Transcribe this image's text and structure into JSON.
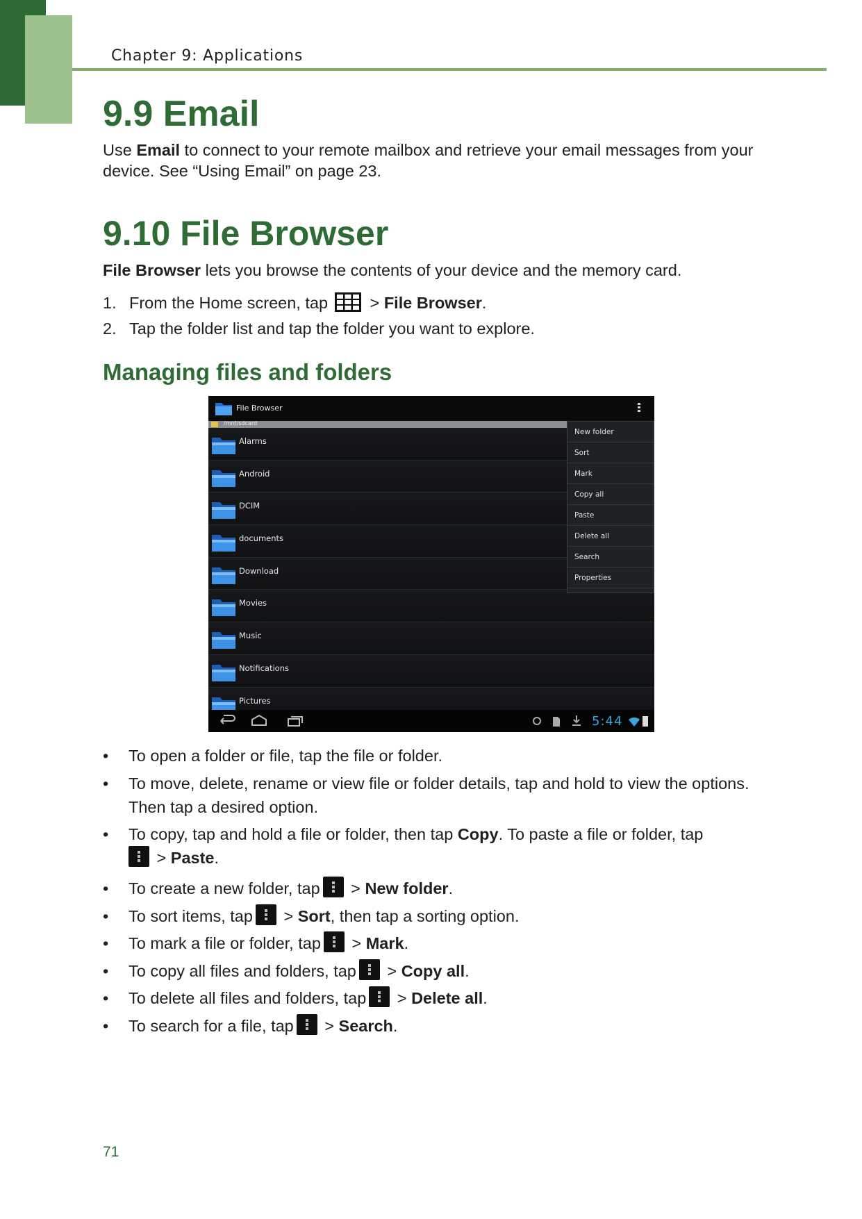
{
  "header": {
    "chapter": "Chapter 9: Applications"
  },
  "email_section": {
    "title": "9.9 Email",
    "text_pre": "Use ",
    "text_bold": "Email",
    "text_post": " to connect to your remote mailbox and retrieve your email messages from your device. See “Using Email” on page 23."
  },
  "fb_section": {
    "title": "9.10 File Browser",
    "intro_bold": "File Browser",
    "intro_rest": " lets you browse the contents of your device and the memory card.",
    "steps": [
      {
        "num": "1.",
        "pre": "From the Home screen, tap",
        "mid": " > ",
        "bold": "File Browser",
        "post": "."
      },
      {
        "num": "2.",
        "text": "Tap the folder list and tap the folder you want to explore."
      }
    ]
  },
  "managing": {
    "title": "Managing files and folders",
    "bullets": [
      {
        "pre": "To open a folder or file, tap the file or folder."
      },
      {
        "pre": "To move, delete, rename or view file or folder details, tap and hold to view the options. Then tap a desired option."
      },
      {
        "pre": "To copy, tap and hold a file or folder, then tap ",
        "bold": "Copy",
        "post": ". To paste a file or folder, tap",
        "bold2": "Paste",
        "post2": "."
      },
      {
        "pre": "To create a new folder, tap",
        "bold": "New folder",
        "post": "."
      },
      {
        "pre": "To sort items, tap",
        "bold": "Sort",
        "post": ", then tap a sorting option."
      },
      {
        "pre": "To mark a file or folder, tap",
        "bold": "Mark",
        "post": "."
      },
      {
        "pre": "To copy all files and folders, tap",
        "bold": "Copy all",
        "post": "."
      },
      {
        "pre": "To delete all files and folders, tap",
        "bold": "Delete all",
        "post": "."
      },
      {
        "pre": "To search for a file, tap",
        "bold": "Search",
        "post": "."
      }
    ]
  },
  "screenshot": {
    "app_title": "File Browser",
    "path": "/mnt/sdcard",
    "folders": [
      "Alarms",
      "Android",
      "DCIM",
      "documents",
      "Download",
      "Movies",
      "Music",
      "Notifications",
      "Pictures"
    ],
    "menu_items": [
      "New folder",
      "Sort",
      "Mark",
      "Copy all",
      "Paste",
      "Delete all",
      "Search",
      "Properties"
    ],
    "clock": "5:44",
    "accent_color": "#3aa6e0"
  },
  "bullet_char": "•",
  "gt": " > ",
  "page_number": "71",
  "colors": {
    "heading": "#2f6b35",
    "tab_dark": "#2f6b35",
    "tab_light": "#9dc18d",
    "rule": "#86ad6a"
  }
}
